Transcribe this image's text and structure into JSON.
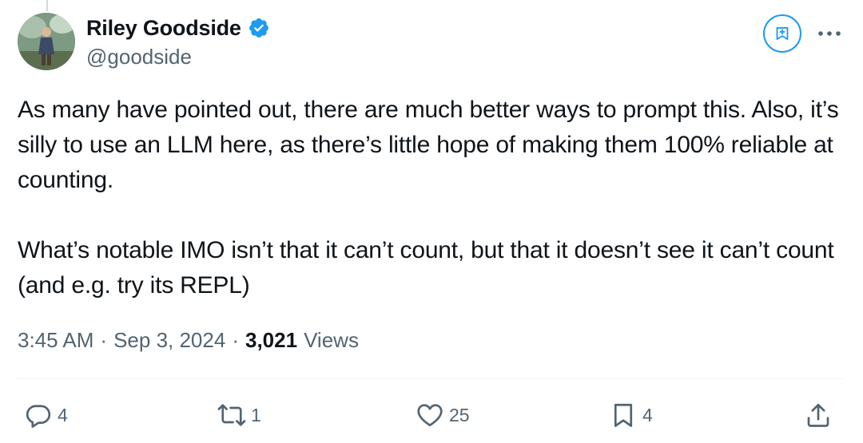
{
  "author": {
    "display_name": "Riley Goodside",
    "handle": "@goodside",
    "verified_color": "#1d9bf0",
    "avatar_icon": "avatar-photo"
  },
  "tweet": {
    "paragraphs": [
      "As many have pointed out, there are much better ways to prompt this. Also, it’s silly to use an LLM here, as there’s little hope of making them 100% reliable at counting.",
      "What’s notable IMO isn’t that it can’t count, but that it doesn’t see it can’t count (and e.g. try its REPL)"
    ]
  },
  "meta": {
    "time": "3:45 AM",
    "date": "Sep 3, 2024",
    "separator": "·",
    "views_count": "3,021",
    "views_label": "Views"
  },
  "actions": {
    "replies": "4",
    "reposts": "1",
    "likes": "25",
    "bookmarks": "4"
  },
  "icons": {
    "reply": "reply-icon",
    "repost": "repost-icon",
    "like": "heart-icon",
    "bookmark": "bookmark-icon",
    "share": "share-icon",
    "grok": "grok-icon",
    "more": "more-icon"
  },
  "colors": {
    "accent": "#1d9bf0",
    "text": "#0f1419",
    "secondary": "#536471"
  }
}
